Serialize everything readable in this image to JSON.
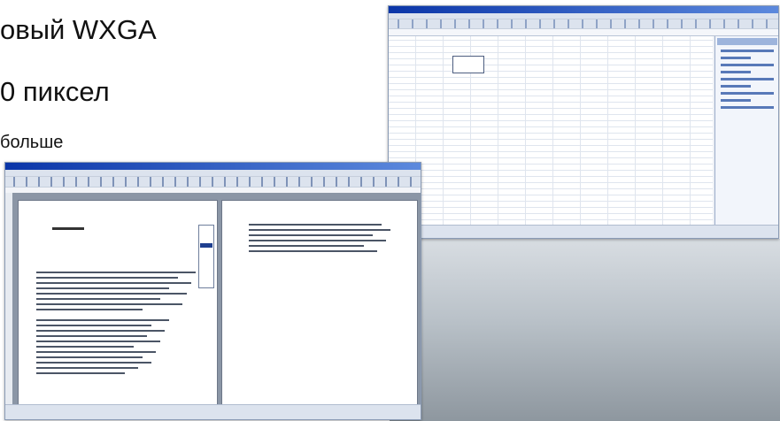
{
  "slide": {
    "line1": "овый WXGA",
    "line2": "0 пиксел",
    "line3": "больше"
  }
}
